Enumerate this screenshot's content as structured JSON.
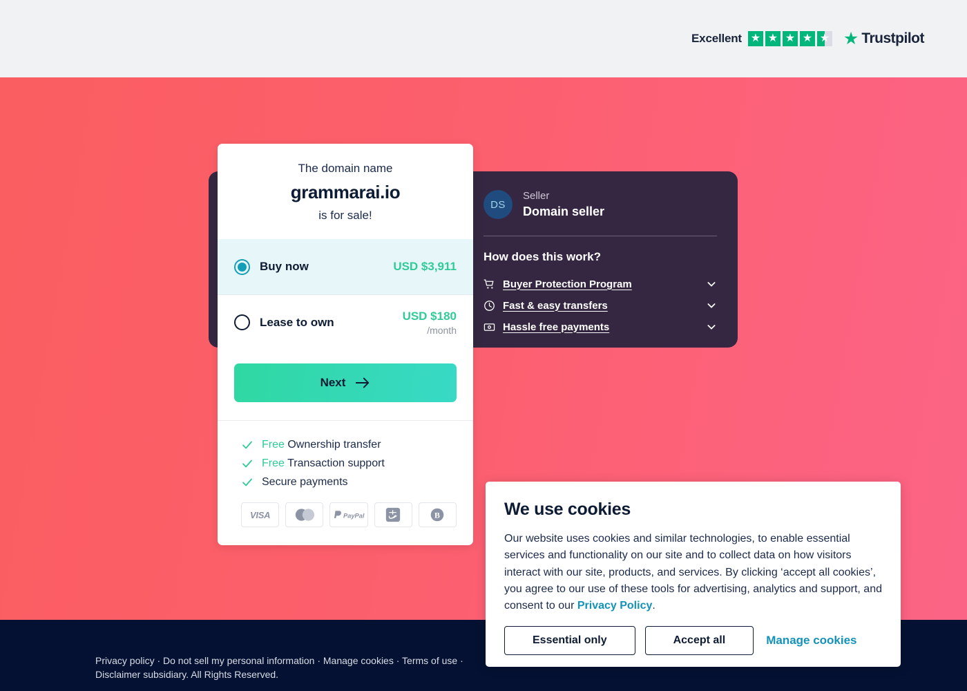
{
  "topbar": {
    "trustpilot": {
      "rating_word": "Excellent",
      "stars_filled": 4.5,
      "brand": "Trustpilot"
    }
  },
  "offer_card": {
    "domain_label": "The domain name",
    "domain_name": "grammarai.io",
    "for_sale_text": "is for sale!",
    "options": [
      {
        "label": "Buy now",
        "price": "USD $3,911",
        "period": "",
        "selected": true
      },
      {
        "label": "Lease to own",
        "price": "USD $180",
        "period": "/month",
        "selected": false
      }
    ],
    "next_label": "Next",
    "features": [
      {
        "free": "Free",
        "text": " Ownership transfer"
      },
      {
        "free": "Free",
        "text": " Transaction support"
      },
      {
        "free": "",
        "text": "Secure payments"
      }
    ],
    "payment_methods": [
      "visa-icon",
      "mastercard-icon",
      "paypal-icon",
      "alipay-icon",
      "bitcoin-icon"
    ],
    "visa_text": "VISA",
    "paypal_text": "PayPal"
  },
  "seller_panel": {
    "avatar_initials": "DS",
    "role": "Seller",
    "name": "Domain seller",
    "how_title": "How does this work?",
    "items": [
      {
        "label": "Buyer Protection Program",
        "icon": "cart-icon"
      },
      {
        "label": "Fast & easy transfers",
        "icon": "clock-icon"
      },
      {
        "label": "Hassle free payments",
        "icon": "banknote-icon"
      }
    ]
  },
  "cookie_banner": {
    "title": "We use cookies",
    "body_before_link": "Our website uses cookies and similar technologies, to enable essential services and functionality on our site and to collect data on how visitors interact with our site, products, and services. By clicking ‘accept all cookies’, you agree to our use of these tools for advertising, analytics and support, and consent to our ",
    "link_text": "Privacy Policy",
    "body_after_link": ".",
    "essential_only_label": "Essential only",
    "accept_all_label": "Accept all",
    "manage_label": "Manage cookies"
  },
  "footer": {
    "text": "Privacy policy · Do not sell my personal information · Manage cookies · Terms of use · Disclaimer subsidiary. All Rights Reserved."
  },
  "colors": {
    "hero_gradient_start": "#fb5e60",
    "hero_gradient_end": "#fc6486",
    "dark_panel": "#352741",
    "accent_green": "#30cb96",
    "accent_teal": "#139fb8",
    "footer_navy": "#051132",
    "trustpilot_green": "#00b67a"
  }
}
